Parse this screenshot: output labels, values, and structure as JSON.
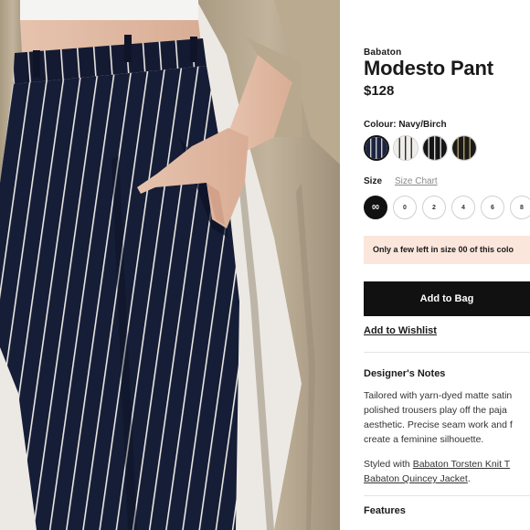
{
  "product": {
    "brand": "Babaton",
    "name": "Modesto Pant",
    "price": "$128",
    "image_alt": "Model wearing navy pinstripe pants with hand in pocket"
  },
  "colour": {
    "label": "Colour: Navy/Birch",
    "swatches": [
      {
        "name": "Navy/Birch",
        "base": "#1b2340",
        "stripe": "#e8e6e0",
        "selected": true
      },
      {
        "name": "Birch/Black",
        "base": "#efede8",
        "stripe": "#1c1c1c",
        "selected": false
      },
      {
        "name": "Black/White",
        "base": "#151515",
        "stripe": "#e8e8e8",
        "selected": false
      },
      {
        "name": "Black/Gold",
        "base": "#1c1a16",
        "stripe": "#b8a57a",
        "selected": false
      }
    ]
  },
  "size": {
    "label": "Size",
    "chart_link": "Size Chart",
    "options": [
      "00",
      "0",
      "2",
      "4",
      "6",
      "8"
    ],
    "selected": "00"
  },
  "notice": "Only a few left in size 00 of this colo",
  "actions": {
    "add_to_bag": "Add to Bag",
    "wishlist": "Add to Wishlist"
  },
  "designers_notes": {
    "heading": "Designer's Notes",
    "lines": [
      "Tailored with yarn-dyed matte satin",
      "polished trousers play off the paja",
      "aesthetic. Precise seam work and f",
      "create a feminine silhouette."
    ],
    "styled_with": {
      "prefix": "Styled with ",
      "link1": "Babaton Torsten Knit T",
      "link2": "Babaton Quincey Jacket",
      "suffix": "."
    }
  },
  "features": {
    "heading": "Features"
  },
  "colors": {
    "accent": "#111111",
    "notice_bg": "#fbe6dc",
    "link_muted": "#8a8a8a"
  }
}
